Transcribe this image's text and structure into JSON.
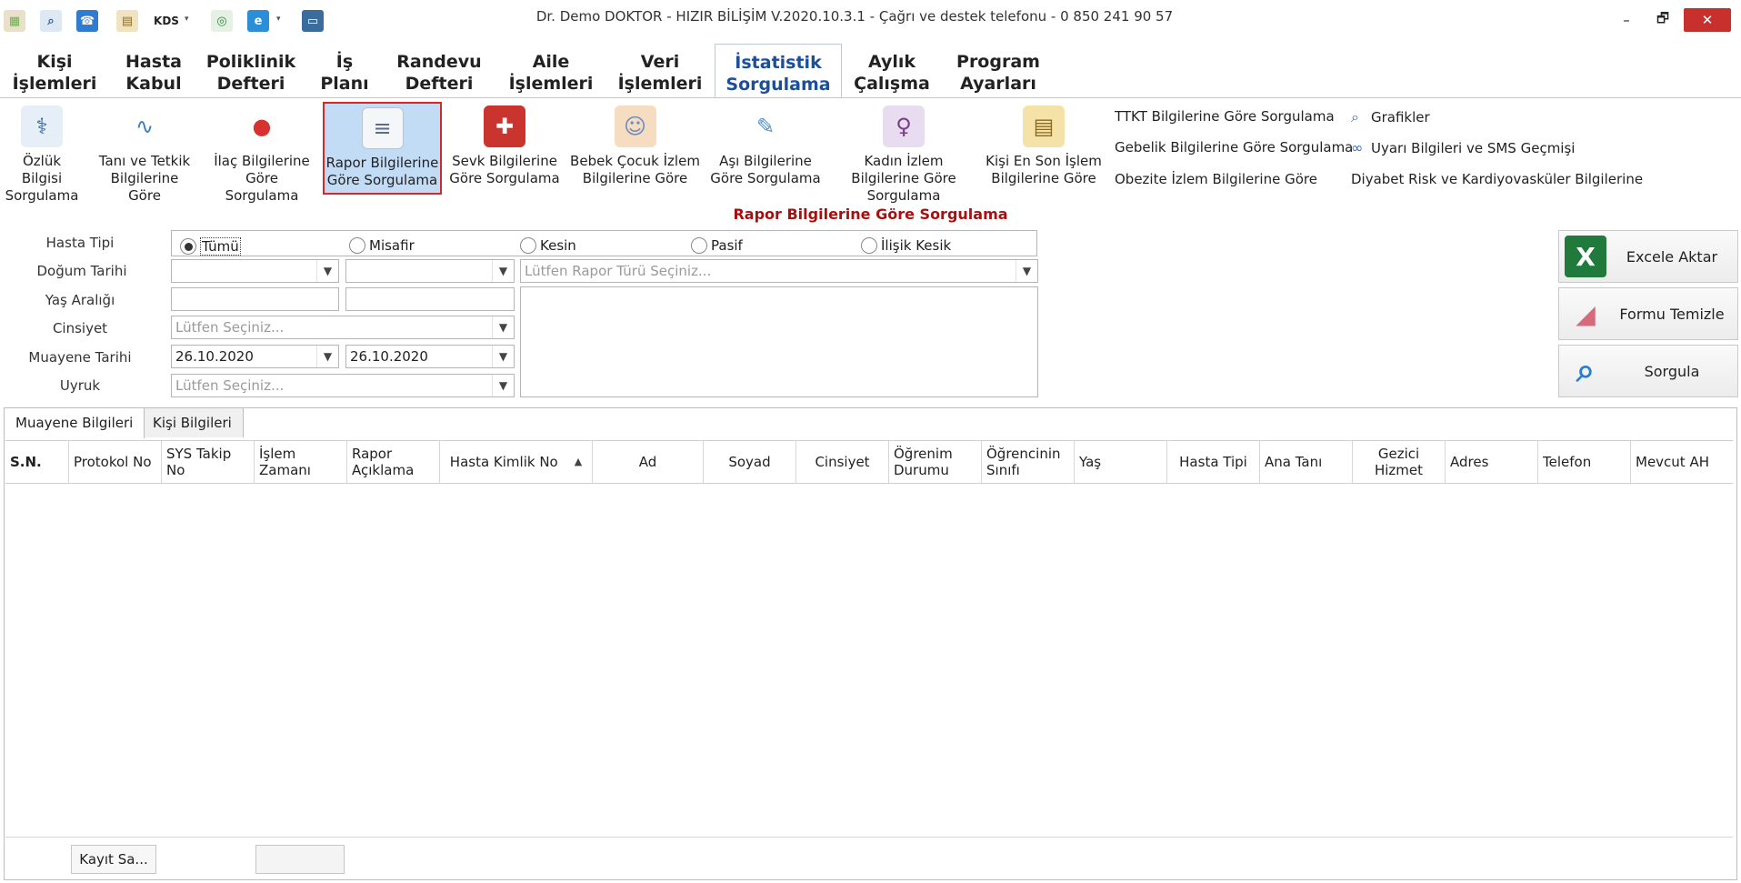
{
  "window": {
    "title": "Dr. Demo DOKTOR - HIZIR BİLİŞİM V.2020.10.3.1 - Çağrı ve destek telefonu - 0 850 241 90 57",
    "minimize": "–",
    "restore": "🗗",
    "close": "✕"
  },
  "quick_toolbar": {
    "kds_label": "KDS",
    "dropdown_glyph": "▾"
  },
  "menu_tabs": [
    {
      "label": "Kişi İşlemleri"
    },
    {
      "label": "Hasta Kabul"
    },
    {
      "label": "Poliklinik Defteri"
    },
    {
      "label": "İş Planı"
    },
    {
      "label": "Randevu Defteri"
    },
    {
      "label": "Aile İşlemleri"
    },
    {
      "label": "Veri İşlemleri"
    },
    {
      "label": "İstatistik Sorgulama"
    },
    {
      "label": "Aylık Çalışma"
    },
    {
      "label": "Program Ayarları"
    }
  ],
  "ribbon": {
    "buttons": [
      {
        "label": "Özlük Bilgisi Sorgulama",
        "icon": "doctor-icon"
      },
      {
        "label": "Tanı ve Tetkik Bilgilerine Göre",
        "icon": "stethoscope-icon"
      },
      {
        "label": "İlaç Bilgilerine Göre Sorgulama",
        "icon": "pill-icon"
      },
      {
        "label": "Rapor Bilgilerine Göre Sorgulama",
        "icon": "report-icon"
      },
      {
        "label": "Sevk Bilgilerine Göre Sorgulama",
        "icon": "ambulance-icon"
      },
      {
        "label": "Bebek Çocuk İzlem Bilgilerine Göre",
        "icon": "baby-icon"
      },
      {
        "label": "Aşı Bilgilerine Göre Sorgulama",
        "icon": "syringe-icon"
      },
      {
        "label": "Kadın İzlem Bilgilerine Göre Sorgulama",
        "icon": "woman-icon"
      },
      {
        "label": "Kişi En Son İşlem Bilgilerine Göre",
        "icon": "clipboard-icon"
      }
    ],
    "links_col1": [
      "TTKT Bilgilerine Göre Sorgulama",
      "Gebelik Bilgilerine Göre Sorgulama",
      "Obezite İzlem Bilgilerine Göre"
    ],
    "links_col2": [
      {
        "label": "Grafikler",
        "icon": "magnifier-icon"
      },
      {
        "label": "Uyarı Bilgileri ve SMS Geçmişi",
        "icon": "binoculars-icon"
      },
      {
        "label": "Diyabet Risk ve Kardiyovasküler Bilgilerine",
        "icon": ""
      }
    ]
  },
  "section_title": "Rapor Bilgilerine Göre Sorgulama",
  "form": {
    "labels": {
      "hasta_tipi": "Hasta Tipi",
      "dogum_tarihi": "Doğum Tarihi",
      "yas_araligi": "Yaş Aralığı",
      "cinsiyet": "Cinsiyet",
      "muayene_tarihi": "Muayene Tarihi",
      "uyruk": "Uyruk"
    },
    "radio_options": [
      "Tümü",
      "Misafir",
      "Kesin",
      "Pasif",
      "İlişik Kesik"
    ],
    "selected_radio": "Tümü",
    "dogum_from": "",
    "dogum_to": "",
    "rapor_turu_placeholder": "Lütfen Rapor Türü Seçiniz...",
    "yas_from": "",
    "yas_to": "",
    "cinsiyet_placeholder": "Lütfen Seçiniz...",
    "muayene_from": "26.10.2020",
    "muayene_to": "26.10.2020",
    "uyruk_placeholder": "Lütfen Seçiniz..."
  },
  "actions": {
    "excel": "Excele Aktar",
    "clear": "Formu Temizle",
    "query": "Sorgula"
  },
  "bottom_tabs": [
    "Muayene Bilgileri",
    "Kişi Bilgileri"
  ],
  "grid": {
    "columns": [
      "S.N.",
      "Protokol No",
      "SYS Takip No",
      "İşlem Zamanı",
      "Rapor Açıklama",
      "Hasta Kimlik No",
      "Ad",
      "Soyad",
      "Cinsiyet",
      "Öğrenim Durumu",
      "Öğrencinin Sınıfı",
      "Yaş",
      "Hasta Tipi",
      "Ana Tanı",
      "Gezici Hizmet",
      "Adres",
      "Telefon",
      "Mevcut AH"
    ],
    "sort_glyph": "▲",
    "record_button": "Kayıt Sa..."
  }
}
